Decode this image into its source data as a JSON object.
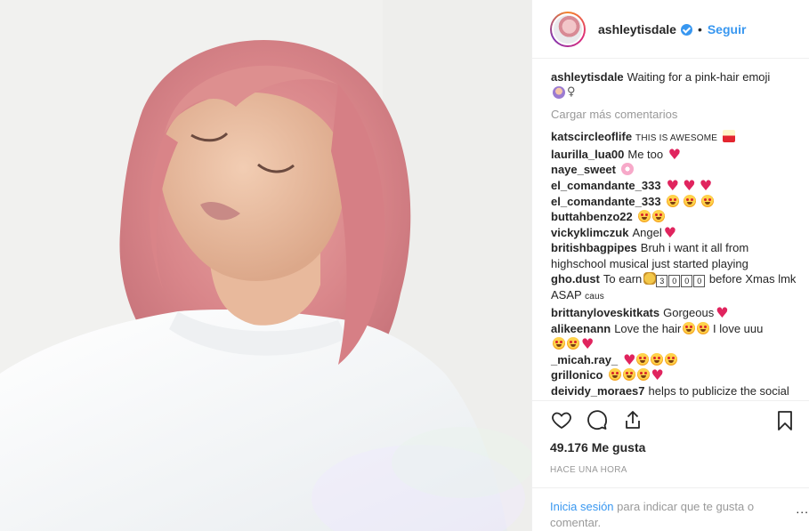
{
  "post": {
    "username": "ashleytisdale",
    "follow_label": "Seguir",
    "separator": "•"
  },
  "caption": {
    "username": "ashleytisdale",
    "text": "Waiting for a pink-hair emoji"
  },
  "load_more_label": "Cargar más comentarios",
  "comments": [
    {
      "user": "katscircleoflife",
      "text": "THIS IS AWESOME"
    },
    {
      "user": "laurilla_lua00",
      "text": "Me too"
    },
    {
      "user": "naye_sweet",
      "text": ""
    },
    {
      "user": "el_comandante_333",
      "text": ""
    },
    {
      "user": "el_comandante_333",
      "text": ""
    },
    {
      "user": "buttahbenzo22",
      "text": ""
    },
    {
      "user": "vickyklimczuk",
      "text": "Angel"
    },
    {
      "user": "britishbagpipes",
      "text": "Bruh i want it all from highschool musical just started playing"
    },
    {
      "user": "gho.dust",
      "text_a": "To earn",
      "digits": [
        "3",
        "0",
        "0",
        "0"
      ],
      "text_b": "before Xmas lmk ASAP",
      "text_c": "caus"
    },
    {
      "user": "brittanyloveskitkats",
      "text": "Gorgeous"
    },
    {
      "user": "alikeenann",
      "text_a": "Love the hair",
      "text_b": "I love uuu"
    },
    {
      "user": "_micah.ray_",
      "text": ""
    },
    {
      "user": "grillonico",
      "text": ""
    },
    {
      "user": "deividy_moraes7",
      "text": "helps to publicize the social action by the neighborhood"
    }
  ],
  "likes_text": "49.176 Me gusta",
  "time_text": "HACE UNA HORA",
  "login": {
    "link": "Inicia sesión",
    "text": "para indicar que te gusta o comentar."
  },
  "more_label": "...",
  "icons": [
    "heart-icon",
    "comment-icon",
    "share-icon",
    "bookmark-icon",
    "verified-badge-icon"
  ],
  "colors": {
    "link": "#3897f0",
    "muted": "#999999",
    "text": "#262626"
  }
}
